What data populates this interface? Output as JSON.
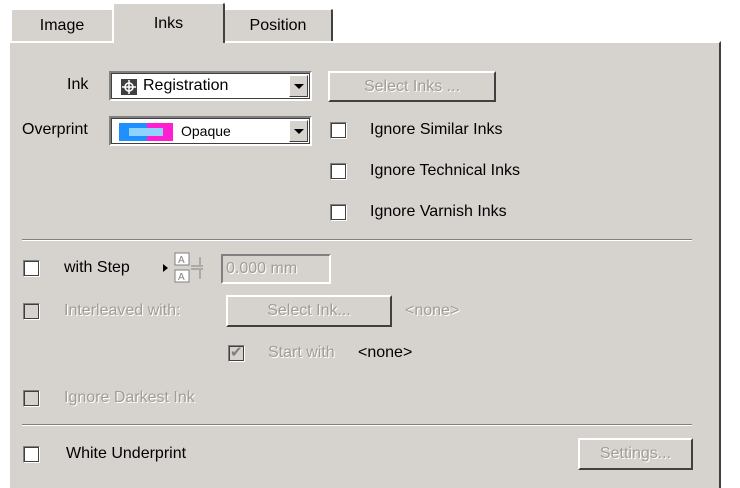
{
  "tabs": [
    {
      "label": "Image"
    },
    {
      "label": "Inks"
    },
    {
      "label": "Position"
    }
  ],
  "ink": {
    "label": "Ink",
    "value": "Registration",
    "select_button": "Select Inks ..."
  },
  "overprint": {
    "label": "Overprint",
    "value": "Opaque"
  },
  "options": {
    "ignore_similar": "Ignore Similar Inks",
    "ignore_technical": "Ignore Technical Inks",
    "ignore_varnish": "Ignore Varnish Inks"
  },
  "step": {
    "label": "with Step",
    "value": "0.000 mm"
  },
  "interleaved": {
    "label": "Interleaved with:",
    "button": "Select Ink...",
    "value": "<none>",
    "start_label": "Start with",
    "start_value": "<none>"
  },
  "ignore_darkest": "Ignore Darkest Ink",
  "white_underprint": {
    "label": "White Underprint",
    "settings_button": "Settings..."
  },
  "colors": {
    "face": "#d6d3ce",
    "disabled_text": "#a09d98",
    "overprint_swatch_left": "#1e90ff",
    "overprint_swatch_right": "#ff00ff"
  }
}
